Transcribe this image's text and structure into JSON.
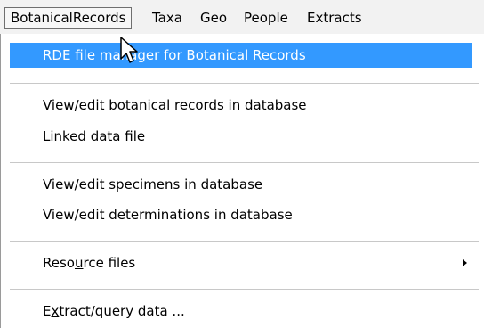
{
  "menubar": {
    "items": [
      {
        "label": "BotanicalRecords"
      },
      {
        "label": "Taxa"
      },
      {
        "label": "Geo"
      },
      {
        "label": "People"
      },
      {
        "label": "Extracts"
      }
    ]
  },
  "menu": {
    "rde_manager": "RDE file manager for Botanical Records",
    "view_botanical": {
      "pre": "View/edit ",
      "ul": "b",
      "post": "otanical records in database"
    },
    "linked_data": "Linked data file",
    "view_specimens": "View/edit specimens in database",
    "view_determinations": "View/edit determinations in database",
    "resource_files": {
      "pre": "Reso",
      "ul": "u",
      "post": "rce files"
    },
    "extract_query": {
      "pre": "E",
      "ul": "x",
      "post": "tract/query data ..."
    }
  },
  "colors": {
    "highlight": "#3399ff",
    "menubar_bg": "#f2f2f2"
  },
  "icons": {
    "cursor": "arrow-pointer-icon",
    "submenu": "triangle-right-icon"
  }
}
